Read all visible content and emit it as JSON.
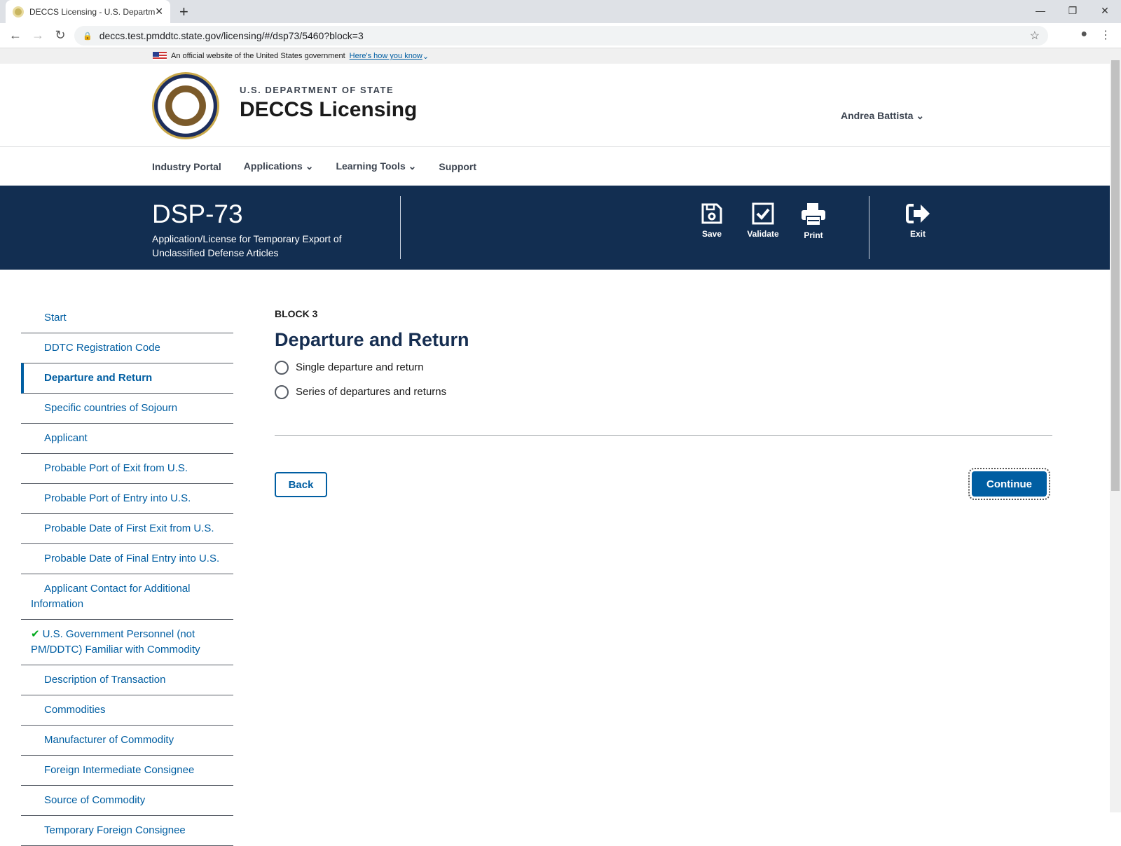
{
  "browser": {
    "tab_title": "DECCS Licensing - U.S. Department of State",
    "url": "deccs.test.pmddtc.state.gov/licensing/#/dsp73/5460?block=3"
  },
  "banner": {
    "text": "An official website of the United States government",
    "link": "Here's how you know"
  },
  "header": {
    "dept": "U.S. DEPARTMENT OF STATE",
    "site": "DECCS Licensing",
    "user": "Andrea Battista"
  },
  "nav": [
    "Industry Portal",
    "Applications",
    "Learning Tools",
    "Support"
  ],
  "form": {
    "code": "DSP-73",
    "desc": "Application/License for Temporary Export of Unclassified Defense Articles"
  },
  "actions": {
    "save": "Save",
    "validate": "Validate",
    "print": "Print",
    "exit": "Exit"
  },
  "sidebar": [
    "Start",
    "DDTC Registration Code",
    "Departure and Return",
    "Specific countries of Sojourn",
    "Applicant",
    "Probable Port of Exit from U.S.",
    "Probable Port of Entry into U.S.",
    "Probable Date of First Exit from U.S.",
    "Probable Date of Final Entry into U.S.",
    "Applicant Contact for Additional Information",
    "U.S. Government Personnel (not PM/DDTC) Familiar with Commodity",
    "Description of Transaction",
    "Commodities",
    "Manufacturer of Commodity",
    "Foreign Intermediate Consignee",
    "Source of Commodity",
    "Temporary Foreign Consignee"
  ],
  "sidebar_current": 2,
  "sidebar_completed": [
    10
  ],
  "main": {
    "block": "BLOCK 3",
    "title": "Departure and Return",
    "options": [
      "Single departure and return",
      "Series of departures and returns"
    ],
    "back": "Back",
    "continue": "Continue"
  },
  "colors": {
    "band": "#122e51",
    "primary": "#005ea2",
    "check": "#00a91c"
  }
}
